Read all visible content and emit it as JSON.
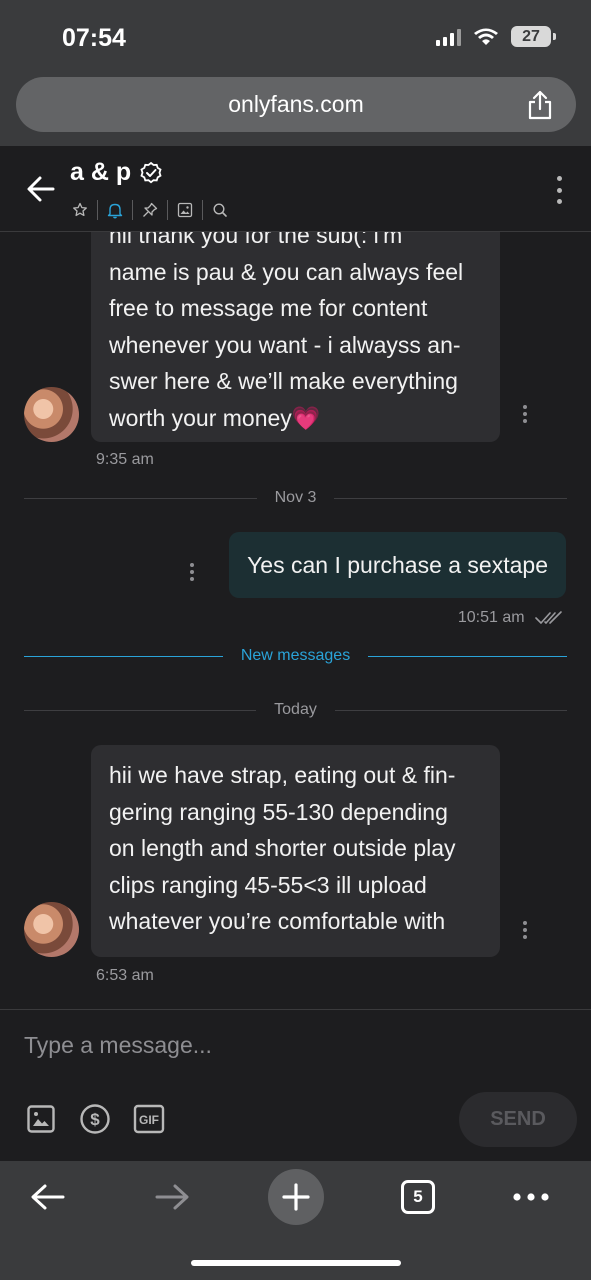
{
  "status_bar": {
    "time": "07:54",
    "battery": "27"
  },
  "browser": {
    "url": "onlyfans.com",
    "tab_count": "5"
  },
  "chat": {
    "title": "a & p",
    "header_tools": [
      "star-icon",
      "bell-icon",
      "pin-icon",
      "image-icon",
      "search-icon"
    ]
  },
  "messages": {
    "first_partial_text": "hii thank you for the sub(: i'm",
    "first_lines": [
      "name is pau & you can always feel",
      "free to message me for content",
      "whenever you want - i alwayss an-",
      "swer here & we’ll make everything",
      "worth your money💗"
    ],
    "first_time": "9:35 am",
    "divider_date_1": "Nov 3",
    "outgoing_text": "Yes can I purchase a sextape",
    "outgoing_time": "10:51 am",
    "new_messages_label": "New messages",
    "divider_date_2": "Today",
    "second_lines": [
      "hii we have strap, eating out & fin-",
      "gering ranging 55-130 depending",
      "on length and shorter outside play",
      "clips ranging 45-55<3 ill upload",
      "whatever you’re comfortable with"
    ],
    "second_time": "6:53 am"
  },
  "composer": {
    "placeholder": "Type a message...",
    "send_label": "SEND",
    "gif_label": "GIF"
  },
  "colors": {
    "accent": "#2aa3d8",
    "outgoing_bubble": "#1c2f33",
    "incoming_bubble": "#2e2e31"
  }
}
